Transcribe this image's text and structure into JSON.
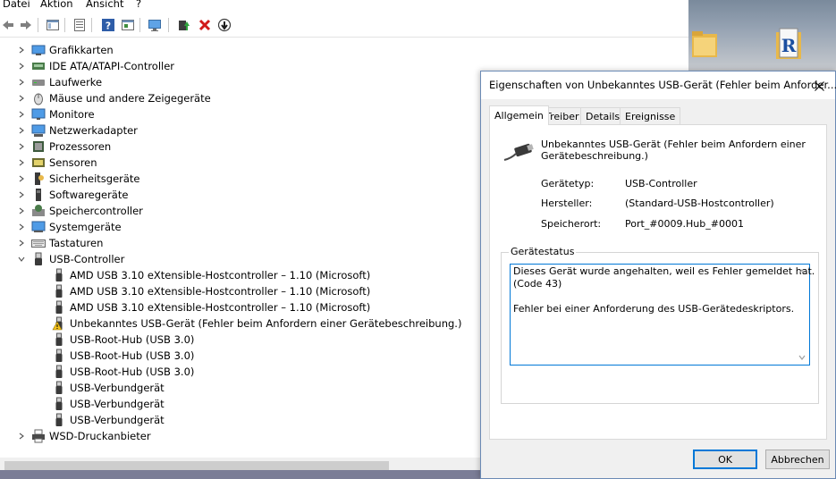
{
  "menu": {
    "items": [
      "Datei",
      "Aktion",
      "Ansicht",
      "?"
    ]
  },
  "toolbar": {
    "icons": [
      "back-arrow-icon",
      "forward-arrow-icon",
      "console-tree-icon",
      "properties-icon",
      "help-icon",
      "view-icon",
      "monitor-scan-icon",
      "update-driver-icon",
      "uninstall-x-icon",
      "disable-device-icon"
    ]
  },
  "tree": {
    "categories": [
      {
        "label": "Grafikkarten",
        "icon": "display-adapter-icon"
      },
      {
        "label": "IDE ATA/ATAPI-Controller",
        "icon": "ide-controller-icon"
      },
      {
        "label": "Laufwerke",
        "icon": "disk-drive-icon"
      },
      {
        "label": "Mäuse und andere Zeigegeräte",
        "icon": "mouse-icon"
      },
      {
        "label": "Monitore",
        "icon": "monitor-icon"
      },
      {
        "label": "Netzwerkadapter",
        "icon": "network-adapter-icon"
      },
      {
        "label": "Prozessoren",
        "icon": "processor-icon"
      },
      {
        "label": "Sensoren",
        "icon": "sensor-icon"
      },
      {
        "label": "Sicherheitsgeräte",
        "icon": "security-device-icon"
      },
      {
        "label": "Softwaregeräte",
        "icon": "software-device-icon"
      },
      {
        "label": "Speichercontroller",
        "icon": "storage-controller-icon"
      },
      {
        "label": "Systemgeräte",
        "icon": "system-device-icon"
      },
      {
        "label": "Tastaturen",
        "icon": "keyboard-icon"
      },
      {
        "label": "USB-Controller",
        "icon": "usb-icon"
      }
    ],
    "usb_children": [
      {
        "label": "AMD USB 3.10 eXtensible-Hostcontroller – 1.10 (Microsoft)",
        "warning": false
      },
      {
        "label": "AMD USB 3.10 eXtensible-Hostcontroller – 1.10 (Microsoft)",
        "warning": false
      },
      {
        "label": "AMD USB 3.10 eXtensible-Hostcontroller – 1.10 (Microsoft)",
        "warning": false
      },
      {
        "label": "Unbekanntes USB-Gerät (Fehler beim Anfordern einer Gerätebeschreibung.)",
        "warning": true
      },
      {
        "label": "USB-Root-Hub (USB 3.0)",
        "warning": false
      },
      {
        "label": "USB-Root-Hub (USB 3.0)",
        "warning": false
      },
      {
        "label": "USB-Root-Hub (USB 3.0)",
        "warning": false
      },
      {
        "label": "USB-Verbundgerät",
        "warning": false
      },
      {
        "label": "USB-Verbundgerät",
        "warning": false
      },
      {
        "label": "USB-Verbundgerät",
        "warning": false
      }
    ],
    "last_category": {
      "label": "WSD-Druckanbieter",
      "icon": "printer-icon"
    }
  },
  "dialog": {
    "title": "Eigenschaften von Unbekanntes USB-Gerät (Fehler beim Anforder...",
    "tabs": [
      "Allgemein",
      "Treiber",
      "Details",
      "Ereignisse"
    ],
    "device_name_line1": "Unbekanntes USB-Gerät (Fehler beim Anfordern einer",
    "device_name_line2": "Gerätebeschreibung.)",
    "fields": [
      {
        "label": "Gerätetyp:",
        "value": "USB-Controller"
      },
      {
        "label": "Hersteller:",
        "value": "(Standard-USB-Hostcontroller)"
      },
      {
        "label": "Speicherort:",
        "value": "Port_#0009.Hub_#0001"
      }
    ],
    "status_group_label": "Gerätestatus",
    "status_lines": [
      "Dieses Gerät wurde angehalten, weil es Fehler gemeldet hat.",
      "(Code 43)",
      "",
      "Fehler bei einer Anforderung des USB-Gerätedeskriptors."
    ],
    "ok_label": "OK",
    "cancel_label": "Abbrechen"
  }
}
